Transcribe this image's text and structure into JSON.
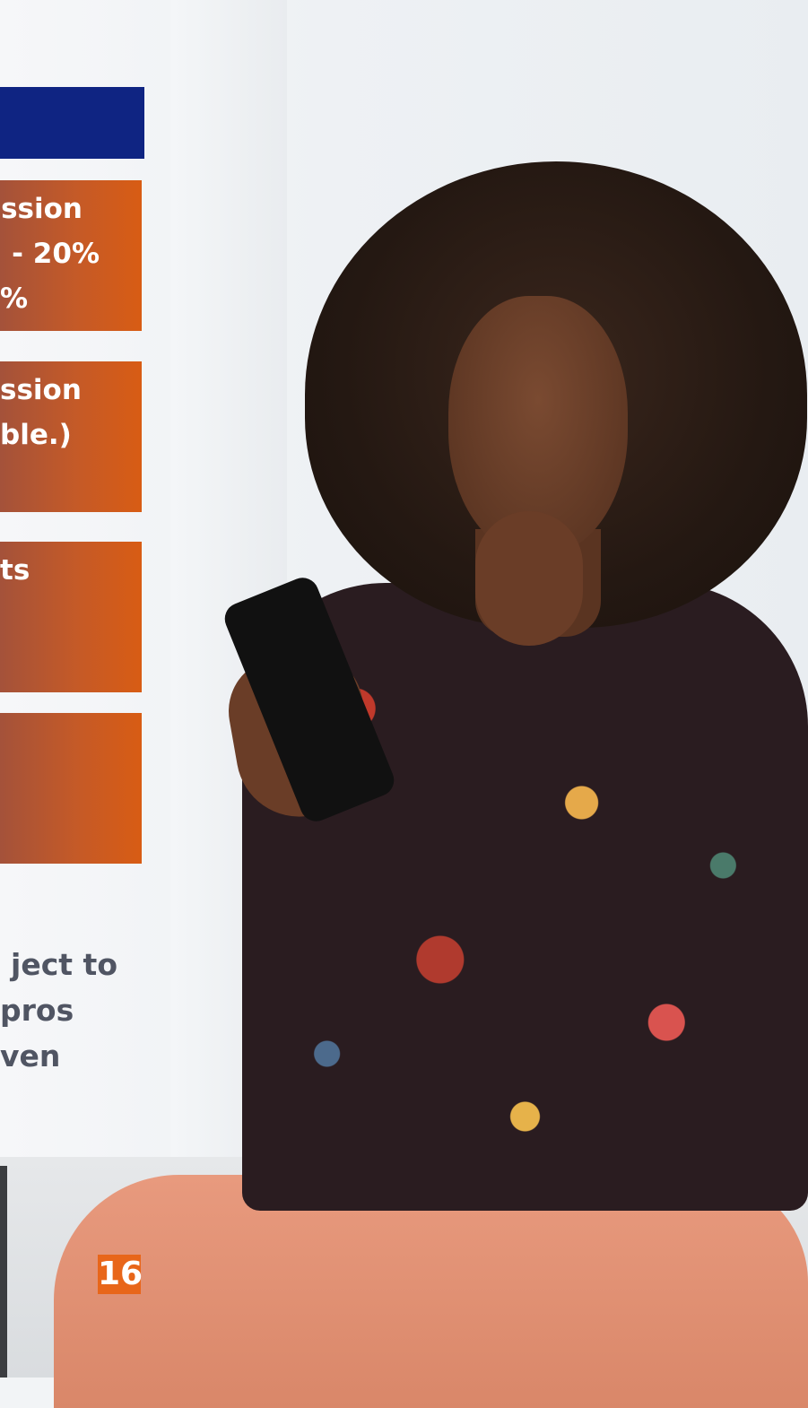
{
  "cards": [
    {
      "lines": [
        "ssion",
        "- 20%",
        "%"
      ]
    },
    {
      "lines": [
        "ssion",
        "ble.)"
      ]
    },
    {
      "lines": [
        "ts"
      ]
    },
    {
      "lines": []
    }
  ],
  "note": {
    "lines": [
      "ject to",
      "pros",
      "ven"
    ]
  },
  "page": {
    "number": "16"
  },
  "colors": {
    "header_bar": "#0f2482",
    "card_gradient_start": "#a4523a",
    "card_gradient_end": "#d85c14",
    "page_badge": "#e8661a"
  }
}
